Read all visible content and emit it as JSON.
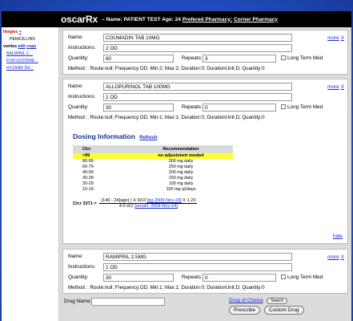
{
  "header": {
    "app_name": "oscarRx",
    "name_label": "Name: PATIENT TEST",
    "age_label": "Age: 24",
    "pharmacy_label": "Prefered Pharmacy:",
    "pharmacy_name": "Corner Pharmacy"
  },
  "sidebar": {
    "allergies_title": "llergies",
    "allergies_link": "+",
    "allergies": [
      "PENICILLINS"
    ],
    "favorites_title": "vorites",
    "favorites_edit": "edit",
    "favorites_copy": "copy",
    "favorites": [
      "BALMINIL C...",
      "FOR GOODNE...",
      "HYZAAR 50/..."
    ]
  },
  "labels": {
    "name": "Name:",
    "instructions": "Instructions:",
    "quantity": "Quantity:",
    "repeats": "Repeats:",
    "long_term": "Long Term Med",
    "more": "more",
    "close": "X",
    "drug_name": "Drug Name:",
    "drug_of_choice": "Drug of Choice",
    "search": "Search",
    "prescribe": "Prescribe",
    "custom_drug": "Custom Drug",
    "hide": "hide"
  },
  "prescriptions": [
    {
      "name": "COUMADIN TAB 10MG",
      "instructions": "2 OD",
      "quantity": "60",
      "repeats": "3",
      "method": "Method: ; Route:null; Frequency:OD; Min:2; Max:2; Duration:0; DurationUnit:D; Quantity:0"
    },
    {
      "name": "ALLOPURINOL TAB 100MG",
      "instructions": "1 OD",
      "quantity": "30",
      "repeats": "0",
      "method": "Method: ; Route:null; Frequency:OD; Min:1; Max:1; Duration:0; DurationUnit:D; Quantity:0"
    },
    {
      "name": "RAMIPRIL 2.5MG",
      "instructions": "1 OD",
      "quantity": "30",
      "repeats": "0",
      "method": "Method: ; Route:null; Frequency:OD; Min:1; Max:1; Duration:0; DurationUnit:D; Quantity:0"
    }
  ],
  "dosing": {
    "title": "Dosing Information",
    "refresh": "Refresh",
    "col_clcr": "Clcr",
    "col_rec": "Recommendation",
    "rows": [
      {
        "clcr": ">99",
        "rec": "no adjustment needed",
        "highlight": true
      },
      {
        "clcr": "80-99",
        "rec": "300 mg daily"
      },
      {
        "clcr": "60-79",
        "rec": "250 mg daily"
      },
      {
        "clcr": "40-59",
        "rec": "200 mg daily"
      },
      {
        "clcr": "30-39",
        "rec": "150 mg daily"
      },
      {
        "clcr": "20-29",
        "rec": "100 mg daily"
      },
      {
        "clcr": "10-19",
        "rec": "100 mg q2days"
      }
    ],
    "formula_label": "Clcr 3371 =",
    "formula_num_a": "(140 - 24[age] ) X 93.0",
    "formula_num_link": "[kg 2009-Nov-24]",
    "formula_num_b": "X 1.23",
    "formula_den_a": "4.0 xCr",
    "formula_den_link": "[umol/L 2009-Nov-24]"
  },
  "colors": {
    "background": "#2552c9",
    "header": "#000000",
    "highlight": "#ffff33",
    "link": "#1a2fcf",
    "allergy": "#cc0000"
  }
}
